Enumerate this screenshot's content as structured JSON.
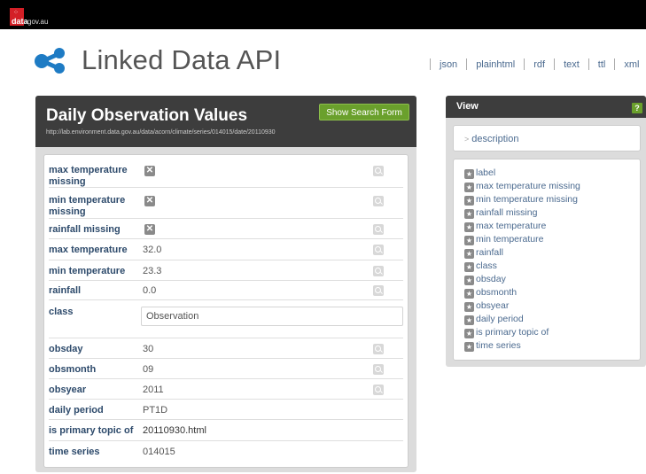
{
  "brand": {
    "logo_text": "data",
    "logo_sub": "gov.au"
  },
  "header": {
    "title": "Linked Data API",
    "formats": [
      "json",
      "plainhtml",
      "rdf",
      "text",
      "ttl",
      "xml"
    ]
  },
  "main": {
    "title": "Daily Observation Values",
    "url": "http://lab.environment.data.gov.au/data/acorn/climate/series/014015/date/20110930",
    "search_button": "Show Search Form",
    "rows": [
      {
        "label": "max temperature missing",
        "value": "",
        "icon": "x"
      },
      {
        "label": "min temperature missing",
        "value": "",
        "icon": "x"
      },
      {
        "label": "rainfall missing",
        "value": "",
        "icon": "x"
      },
      {
        "label": "max temperature",
        "value": "32.0"
      },
      {
        "label": "min temperature",
        "value": "23.3"
      },
      {
        "label": "rainfall",
        "value": "0.0"
      },
      {
        "label": "class",
        "value": "Observation"
      },
      {
        "label": "obsday",
        "value": "30"
      },
      {
        "label": "obsmonth",
        "value": "09"
      },
      {
        "label": "obsyear",
        "value": "2011"
      },
      {
        "label": "daily period",
        "value": "PT1D"
      },
      {
        "label": "is primary topic of",
        "value": "20110930.html"
      },
      {
        "label": "time series",
        "value": "014015"
      }
    ]
  },
  "view": {
    "title": "View",
    "help": "?",
    "description": "description",
    "items": [
      "label",
      "max temperature missing",
      "min temperature missing",
      "rainfall missing",
      "max temperature",
      "min temperature",
      "rainfall",
      "class",
      "obsday",
      "obsmonth",
      "obsyear",
      "daily period",
      "is primary topic of",
      "time series"
    ]
  }
}
